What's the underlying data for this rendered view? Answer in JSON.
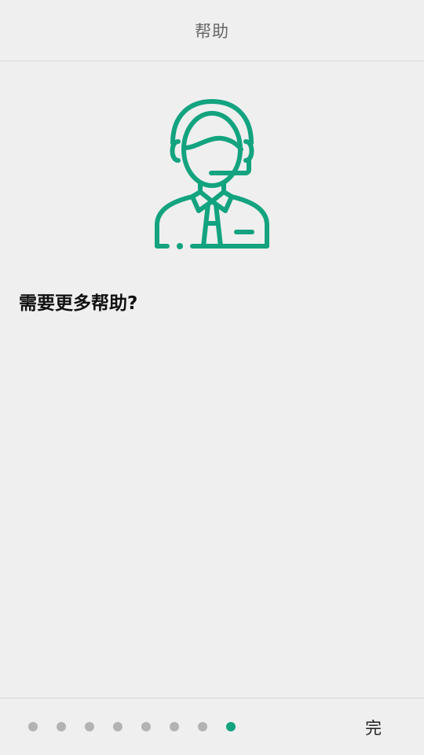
{
  "header": {
    "title": "帮助"
  },
  "illustration": {
    "icon": "support-agent-icon",
    "color": "#13a37f"
  },
  "main": {
    "headline": "需要更多帮助?"
  },
  "footer": {
    "page_count": 8,
    "current_page": 8,
    "done_label": "完",
    "dot_color": "#b3b3b3",
    "active_dot_color": "#13a37f"
  }
}
